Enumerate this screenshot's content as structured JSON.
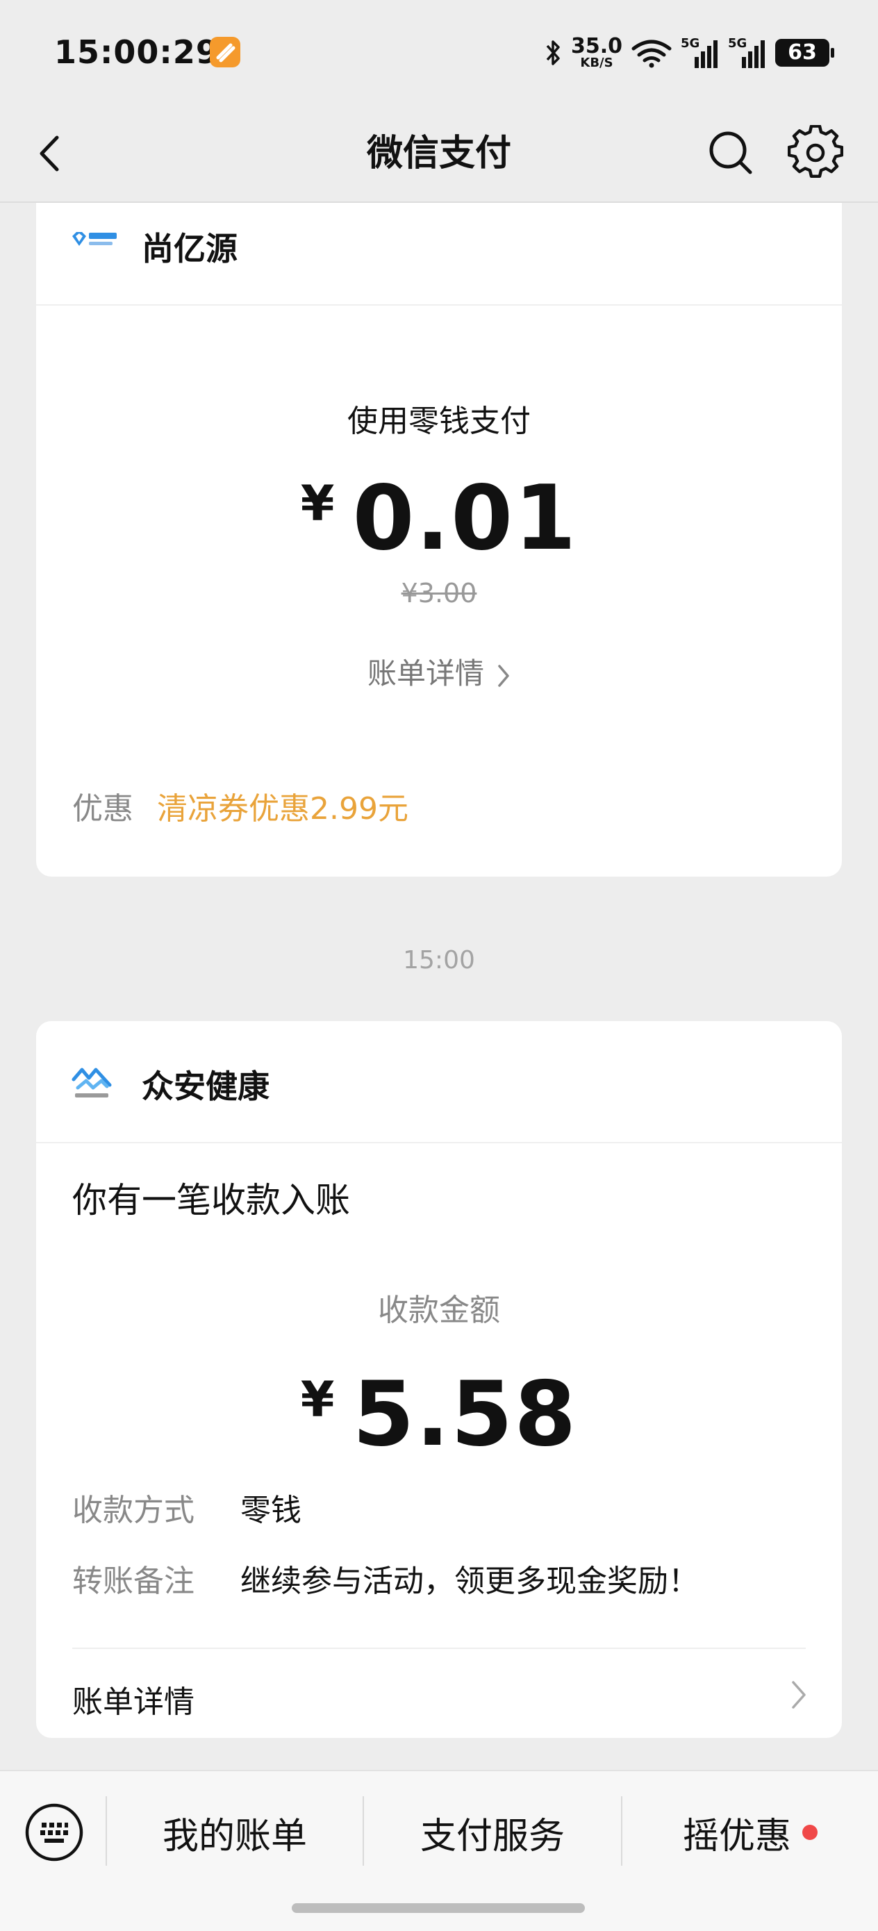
{
  "status_bar": {
    "time": "15:00:29",
    "net_speed_value": "35.0",
    "net_speed_unit": "KB/S",
    "sim1_label": "5G",
    "sim2_label": "5G",
    "battery": "63"
  },
  "nav": {
    "title": "微信支付"
  },
  "card1": {
    "merchant_name": "尚亿源",
    "pay_method": "使用零钱支付",
    "currency": "¥",
    "amount": "0.01",
    "original_price": "¥3.00",
    "detail_link": "账单详情",
    "promo_label": "优惠",
    "promo_value": "清凉券优惠2.99元"
  },
  "time_separator": "15:00",
  "card2": {
    "merchant_name": "众安健康",
    "title": "你有一笔收款入账",
    "amount_label": "收款金额",
    "currency": "¥",
    "amount": "5.58",
    "method_label": "收款方式",
    "method_value": "零钱",
    "note_label": "转账备注",
    "note_value": "继续参与活动，领更多现金奖励！",
    "detail_link": "账单详情"
  },
  "bottom_menu": {
    "items": [
      "我的账单",
      "支付服务",
      "摇优惠"
    ]
  },
  "colors": {
    "promo": "#e9a33a",
    "red_dot": "#f04848",
    "logo_blue": "#2f8fe4"
  }
}
